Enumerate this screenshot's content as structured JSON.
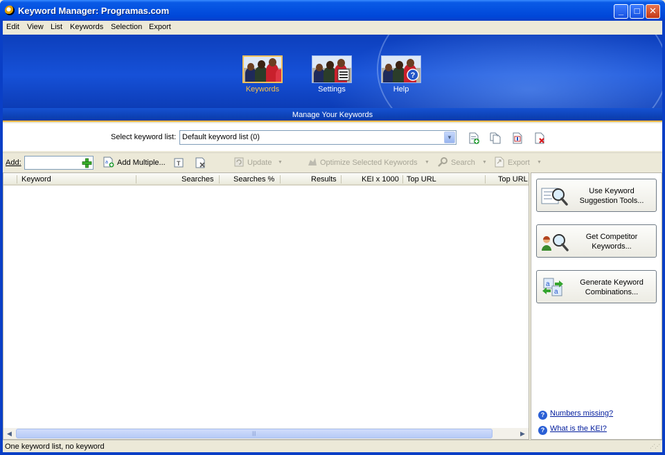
{
  "window": {
    "title": "Keyword Manager: Programas.com",
    "min_icon": "minimize-icon",
    "max_icon": "maximize-icon",
    "close_icon": "close-icon"
  },
  "menu": [
    "Edit",
    "View",
    "List",
    "Keywords",
    "Selection",
    "Export"
  ],
  "nav": {
    "items": [
      {
        "label": "Keywords",
        "icon": "keywords-photo-icon",
        "active": true
      },
      {
        "label": "Settings",
        "icon": "settings-photo-icon",
        "active": false
      },
      {
        "label": "Help",
        "icon": "help-photo-icon",
        "active": false
      }
    ],
    "subtitle": "Manage Your Keywords"
  },
  "keyword_list": {
    "label": "Select keyword list:",
    "selected": "Default keyword list (0)",
    "tools": [
      "new-list-icon",
      "copy-list-icon",
      "rename-list-icon",
      "delete-list-icon"
    ]
  },
  "toolbar": {
    "add_label": "Add:",
    "add_value": "",
    "add_multiple": "Add Multiple...",
    "update": "Update",
    "optimize": "Optimize Selected Keywords",
    "search": "Search",
    "export": "Export"
  },
  "table": {
    "columns": [
      "Keyword",
      "Searches",
      "Searches %",
      "Results",
      "KEI x 1000",
      "Top URL",
      "Top URL"
    ],
    "rows": []
  },
  "side_panel": {
    "buttons": [
      {
        "line1": "Use Keyword",
        "line2": "Suggestion Tools...",
        "icon": "suggestion-magnifier-icon"
      },
      {
        "line1": "Get Competitor",
        "line2": "Keywords...",
        "icon": "competitor-magnifier-icon"
      },
      {
        "line1": "Generate Keyword",
        "line2": "Combinations...",
        "icon": "combinations-icon"
      }
    ],
    "links": [
      "Numbers missing?",
      "What is the KEI?"
    ]
  },
  "status": "One keyword list, no keyword",
  "colors": {
    "accent": "#0a3fc6",
    "active_nav": "#f8c24c",
    "link": "#001b9c"
  }
}
